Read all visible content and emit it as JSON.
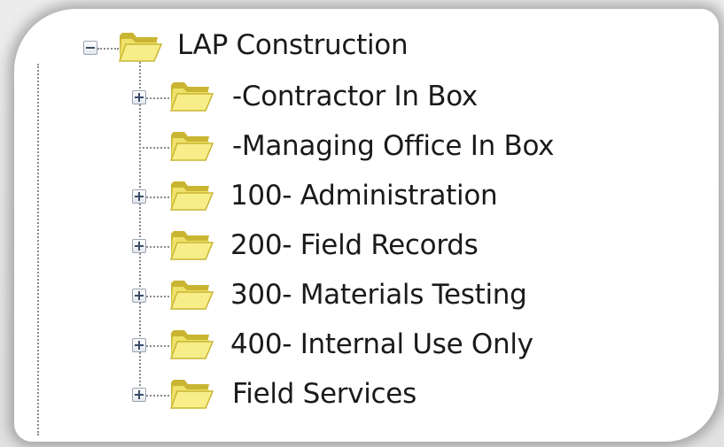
{
  "tree": {
    "root": {
      "label": "LAP Construction",
      "expander": "minus",
      "icon": "folder-open-icon"
    },
    "children": [
      {
        "label": "-Contractor In Box",
        "expander": "plus",
        "icon": "folder-open-icon"
      },
      {
        "label": "-Managing Office In Box",
        "expander": "none",
        "icon": "folder-open-icon"
      },
      {
        "label": "100- Administration",
        "expander": "plus",
        "icon": "folder-open-icon"
      },
      {
        "label": "200- Field Records",
        "expander": "plus",
        "icon": "folder-open-icon"
      },
      {
        "label": "300- Materials Testing",
        "expander": "plus",
        "icon": "folder-open-icon"
      },
      {
        "label": "400- Internal Use Only",
        "expander": "plus",
        "icon": "folder-open-icon"
      },
      {
        "label": "Field Services",
        "expander": "plus",
        "icon": "folder-open-icon"
      }
    ]
  },
  "colors": {
    "folder_light": "#f7ee8a",
    "folder_dark": "#c9b531",
    "guide_line": "#8a8a8a",
    "expander_sign": "#3a4d68"
  }
}
